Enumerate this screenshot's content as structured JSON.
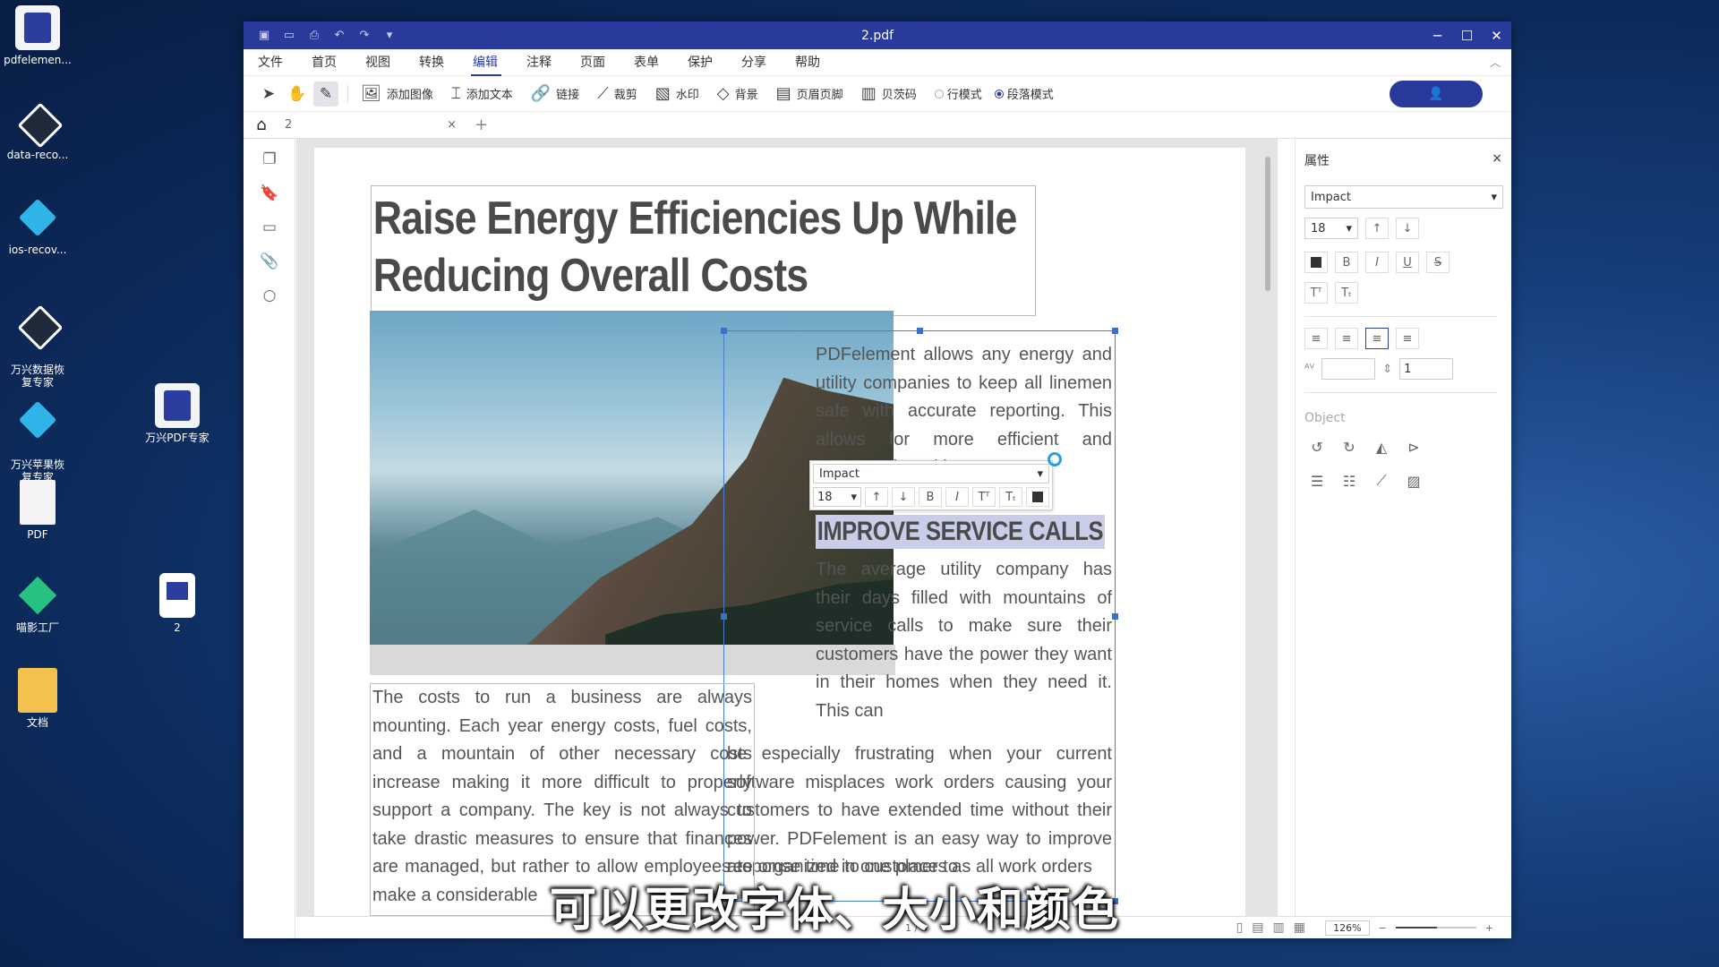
{
  "desktop": {
    "icons": [
      {
        "label": "pdfelemen...",
        "icon": "pdfelement-icon"
      },
      {
        "label": "data-reco...",
        "icon": "data-recovery-icon"
      },
      {
        "label": "ios-recov...",
        "icon": "ios-recovery-icon"
      },
      {
        "label": "万兴数据恢\n复专家",
        "icon": "data-recovery-cn-icon"
      },
      {
        "label": "万兴苹果恢\n复专家",
        "icon": "apple-recovery-cn-icon"
      },
      {
        "label": "PDF",
        "icon": "pdf-file-icon"
      },
      {
        "label": "喵影工厂",
        "icon": "filmora-icon"
      },
      {
        "label": "文档",
        "icon": "folder-icon"
      },
      {
        "label": "万兴PDF专家",
        "icon": "pdfelement-cn-icon"
      },
      {
        "label": "2",
        "icon": "pdf-document-icon"
      }
    ]
  },
  "window": {
    "title": "2.pdf",
    "controls": {
      "minimize": "─",
      "maximize": "☐",
      "close": "✕"
    }
  },
  "menu": [
    "文件",
    "首页",
    "视图",
    "转换",
    "编辑",
    "注释",
    "页面",
    "表单",
    "保护",
    "分享",
    "帮助"
  ],
  "menu_active": "编辑",
  "toolbar": {
    "add_image": "添加图像",
    "add_text": "添加文本",
    "link": "链接",
    "crop": "裁剪",
    "watermark": "水印",
    "background": "背景",
    "header_footer": "页眉页脚",
    "bates": "贝茨码",
    "line_mode": "行模式",
    "paragraph_mode": "段落模式",
    "user_icon": "👤"
  },
  "tab": {
    "name": "2",
    "close": "×",
    "add": "+"
  },
  "document": {
    "headline": "Raise Energy Efficiencies Up While Reducing Overall Costs",
    "right_paragraph": "PDFelement allows any energy and utility companies to keep all linemen safe with accurate reporting. This allows for more efficient and collaborative without",
    "subheading": "IMPROVE SERVICE CALLS",
    "service_paragraph": "The average utility company has their days filled with mountains of service calls to make sure their customers have the power they want in their homes when they need it. This can",
    "service_paragraph_wide": "be especially frustrating when your current software misplaces work orders causing your customers to have extended time without their power. PDFelement is an easy way to improve response time to customers as all work orders",
    "service_paragraph_last": "are organized in one place to",
    "left_paragraph": "The costs to run a business are always mounting. Each year energy costs, fuel costs, and a mountain of other necessary costs increase making it more difficult to properly support a company. The key is not always to take drastic measures to ensure that finances are managed, but rather to allow employees to make a considerable"
  },
  "popup": {
    "font": "Impact",
    "size": "18"
  },
  "subtitle_caption": "可以更改字体、大小和颜色",
  "statusbar": {
    "page": "1 / 3",
    "zoom": "126%",
    "zoom_out": "−",
    "zoom_in": "+"
  },
  "properties": {
    "title": "属性",
    "close": "×",
    "font": "Impact",
    "size": "18",
    "char_spacing": "",
    "line_spacing": "1",
    "object_label": "Object"
  }
}
